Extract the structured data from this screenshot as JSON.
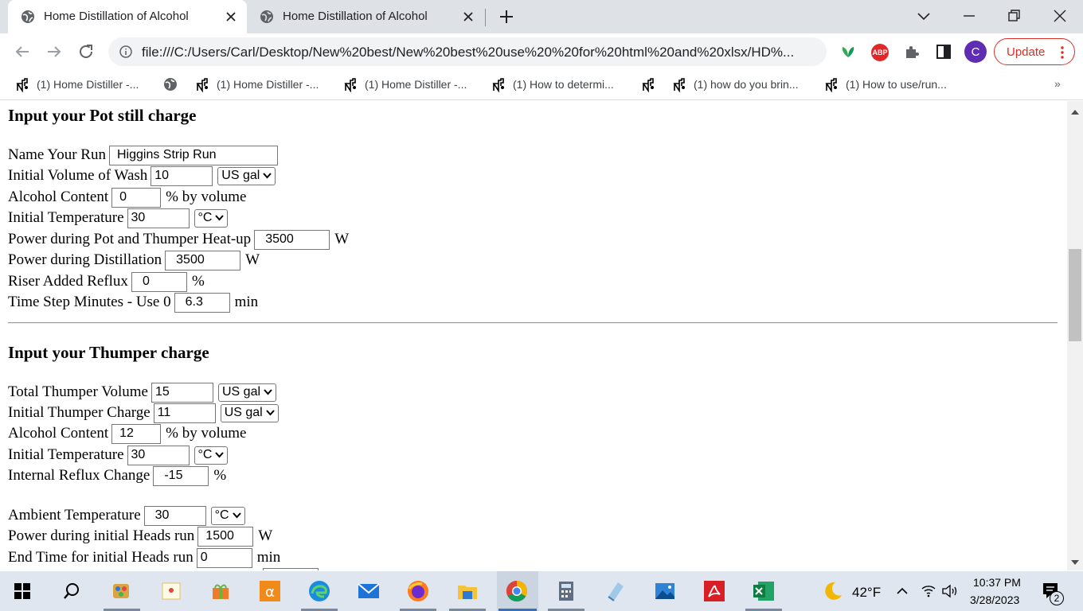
{
  "tabs": [
    {
      "title": "Home Distillation of Alcohol",
      "active": true
    },
    {
      "title": "Home Distillation of Alcohol",
      "active": false
    }
  ],
  "toolbar": {
    "url": "file:///C:/Users/Carl/Desktop/New%20best/New%20best%20use%20%20for%20html%20and%20xlsx/HD%...",
    "abp_label": "ABP",
    "avatar_letter": "C",
    "update_label": "Update"
  },
  "bookmarks": [
    {
      "label": "(1) Home Distiller -...",
      "icon": "distiller-icon"
    },
    {
      "label": "",
      "icon": "globe-icon"
    },
    {
      "label": "(1) Home Distiller -...",
      "icon": "distiller-icon"
    },
    {
      "label": "(1) Home Distiller -...",
      "icon": "distiller-icon"
    },
    {
      "label": "(1) How to determi...",
      "icon": "distiller-icon"
    },
    {
      "label": "",
      "icon": "distiller-icon"
    },
    {
      "label": "(1) how do you brin...",
      "icon": "distiller-icon"
    },
    {
      "label": "(1) How to use/run...",
      "icon": "distiller-icon"
    }
  ],
  "bookmarks_more": "»",
  "pot": {
    "heading": "Input your Pot still charge",
    "run_name_label": "Name Your Run",
    "run_name_value": "Higgins Strip Run",
    "wash_volume_label": "Initial Volume of Wash",
    "wash_volume_value": "10",
    "wash_volume_unit": "US gal",
    "alcohol_label": "Alcohol Content",
    "alcohol_value": "0",
    "alcohol_unit": "% by volume",
    "temp_label": "Initial Temperature",
    "temp_value": "30",
    "temp_unit": "°C",
    "heatup_power_label": "Power during Pot and Thumper Heat-up",
    "heatup_power_value": "3500",
    "heatup_power_unit": "W",
    "distill_power_label": "Power during Distillation",
    "distill_power_value": "3500",
    "distill_power_unit": "W",
    "riser_label": "Riser Added Reflux",
    "riser_value": "0",
    "riser_unit": "%",
    "timestep_label": "Time Step Minutes - Use 0",
    "timestep_value": "6.3",
    "timestep_unit": "min"
  },
  "thumper": {
    "heading": "Input your Thumper charge",
    "total_volume_label": "Total Thumper Volume",
    "total_volume_value": "15",
    "total_volume_unit": "US gal",
    "charge_label": "Initial Thumper Charge",
    "charge_value": "11",
    "charge_unit": "US gal",
    "alcohol_label": "Alcohol Content",
    "alcohol_value": "12",
    "alcohol_unit": "% by volume",
    "temp_label": "Initial Temperature",
    "temp_value": "30",
    "temp_unit": "°C",
    "reflux_label": "Internal Reflux Change",
    "reflux_value": "-15",
    "reflux_unit": "%"
  },
  "ambient": {
    "temp_label": "Ambient Temperature",
    "temp_value": "30",
    "temp_unit": "°C",
    "heads_power_label": "Power during initial Heads run",
    "heads_power_value": "1500",
    "heads_power_unit": "W",
    "heads_end_label": "End Time for initial Heads run",
    "heads_end_value": "0",
    "heads_end_unit": "min"
  },
  "taskbar": {
    "weather": "42°F",
    "time": "10:37 PM",
    "date": "3/28/2023",
    "notifications": "2"
  }
}
